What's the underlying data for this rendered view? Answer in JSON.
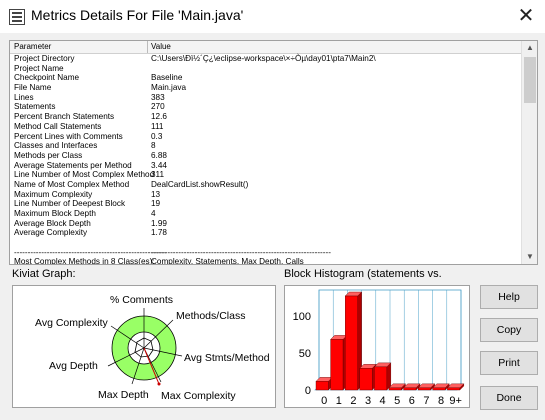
{
  "window": {
    "title": "Metrics Details For File 'Main.java'"
  },
  "table": {
    "headers": [
      "Parameter",
      "Value"
    ],
    "rows": [
      {
        "p": "Project Directory",
        "v": "C:\\Users\\Ðì½´Ç¿\\eclipse-workspace\\×÷Òµ\\day01\\pta7\\Main2\\"
      },
      {
        "p": "Project Name",
        "v": ""
      },
      {
        "p": "Checkpoint Name",
        "v": "Baseline"
      },
      {
        "p": "File Name",
        "v": "Main.java"
      },
      {
        "p": "Lines",
        "v": "383"
      },
      {
        "p": "Statements",
        "v": "270"
      },
      {
        "p": "Percent Branch Statements",
        "v": "12.6"
      },
      {
        "p": "Method Call Statements",
        "v": "111"
      },
      {
        "p": "Percent Lines with Comments",
        "v": "0.3"
      },
      {
        "p": "Classes and Interfaces",
        "v": "8"
      },
      {
        "p": "Methods per Class",
        "v": "6.88"
      },
      {
        "p": "Average Statements per Method",
        "v": "3.44"
      },
      {
        "p": "Line Number of Most Complex Method",
        "v": "311"
      },
      {
        "p": "Name of Most Complex Method",
        "v": "DealCardList.showResult()"
      },
      {
        "p": "Maximum Complexity",
        "v": "13"
      },
      {
        "p": "Line Number of Deepest Block",
        "v": "19"
      },
      {
        "p": "Maximum Block Depth",
        "v": "4"
      },
      {
        "p": "Average Block Depth",
        "v": "1.99"
      },
      {
        "p": "Average Complexity",
        "v": "1.78"
      },
      {
        "p": "",
        "v": ""
      },
      {
        "p": "--------------------------------------------------------",
        "v": "------------------------------------------------------------------"
      },
      {
        "p": "Most Complex Methods in 8 Class(es):",
        "v": "Complexity, Statements, Max Depth, Calls"
      }
    ]
  },
  "kiviat": {
    "title": "Kiviat Graph:",
    "labels": {
      "comments": "% Comments",
      "methods_class": "Methods/Class",
      "avg_stmts": "Avg Stmts/Method",
      "max_complexity": "Max Complexity",
      "max_depth": "Max Depth",
      "avg_depth": "Avg Depth",
      "avg_complexity": "Avg Complexity"
    }
  },
  "histogram": {
    "title": "Block Histogram (statements vs.",
    "ytick_labels": [
      "100",
      "50",
      "0"
    ],
    "categories": [
      "0",
      "1",
      "2",
      "3",
      "4",
      "5",
      "6",
      "7",
      "8",
      "9+"
    ],
    "values": [
      12,
      70,
      130,
      30,
      32,
      3,
      3,
      3,
      3,
      3
    ],
    "ymax": 130,
    "bar_color": "#ff0000"
  },
  "buttons": {
    "help": "Help",
    "copy": "Copy",
    "print": "Print",
    "done": "Done"
  }
}
